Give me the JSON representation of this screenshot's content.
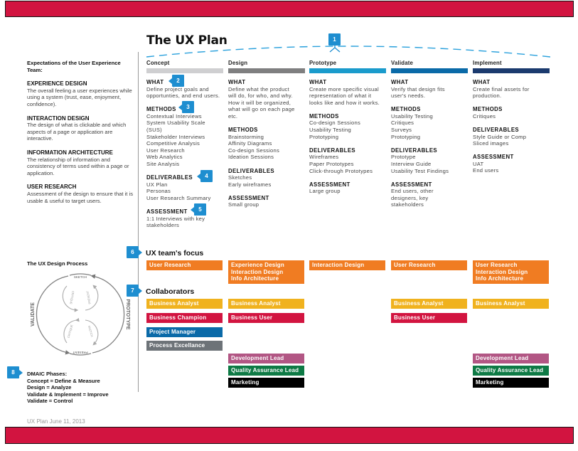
{
  "title": "The UX Plan",
  "intro": "Expectations of the User Experience Team:",
  "definitions": [
    {
      "term": "EXPERIENCE DESIGN",
      "desc": "The overall feeling a user experiences while using a system (trust, ease, enjoyment, confidence)."
    },
    {
      "term": "INTERACTION DESIGN",
      "desc": "The design of what is clickable and which aspects of a page or application are interactive."
    },
    {
      "term": "INFORMATION ARCHITECTURE",
      "desc": "The relationship of information and consistency of terms used within a page or application."
    },
    {
      "term": "USER RESEARCH",
      "desc": "Assessment of the design to ensure that it is usable & useful to target users."
    }
  ],
  "phases": [
    {
      "label": "Concept",
      "color": "#cfcfd1"
    },
    {
      "label": "Design",
      "color": "#7f7f80"
    },
    {
      "label": "Prototype",
      "color": "#1a9bcc"
    },
    {
      "label": "Validate",
      "color": "#0a6aa8"
    },
    {
      "label": "Implement",
      "color": "#1b3a6e"
    }
  ],
  "section_headers": {
    "what": "WHAT",
    "methods": "METHODS",
    "deliverables": "DELIVERABLES",
    "assessment": "ASSESSMENT"
  },
  "columns": [
    {
      "what": [
        "Define project goals and",
        "opportunties, and end users."
      ],
      "methods": [
        "Contextual Interviews",
        "System Usability Scale",
        "(SUS)",
        "Stakeholder Interviews",
        "Competitive Analysis",
        "User Research",
        "Web Analytics",
        "Site Analysis"
      ],
      "deliverables": [
        "UX Plan",
        "Personas",
        "User Research Summary"
      ],
      "assessment": [
        "1:1 Interviews with key",
        "stakeholders"
      ]
    },
    {
      "what": [
        "Define what the product",
        "will do, for who, and why.",
        "How it will be organized,",
        "what will go on each page",
        "etc."
      ],
      "methods": [
        "Brainstorming",
        "Affinity Diagrams",
        "Co-design Sessions",
        "Ideation Sessions"
      ],
      "deliverables": [
        "Sketches",
        "Early wireframes"
      ],
      "assessment": [
        "Small group"
      ]
    },
    {
      "what": [
        "Create more specific visual",
        "representation of what it",
        "looks like and how it works."
      ],
      "methods": [
        "Co-design Sessions",
        "Usability Testing",
        "Prototyping"
      ],
      "deliverables": [
        "Wireframes",
        "Paper Prototypes",
        "Click-through Prototypes"
      ],
      "assessment": [
        "Large group"
      ]
    },
    {
      "what": [
        "Verify that design fits",
        "user's needs."
      ],
      "methods": [
        "Usability Testing",
        "Critiques",
        "Surveys",
        "Prototyping"
      ],
      "deliverables": [
        "Prototype",
        "Interview Guide",
        "Usability Test Findings"
      ],
      "assessment": [
        "End users, other",
        "designers, key",
        "stakeholders"
      ]
    },
    {
      "what": [
        "Create final assets for",
        "production."
      ],
      "methods": [
        "Critiques"
      ],
      "deliverables": [
        "Style Guide or Comp",
        "Sliced images"
      ],
      "assessment": [
        "UAT",
        "End users"
      ]
    }
  ],
  "callouts": [
    "1",
    "2",
    "3",
    "4",
    "5",
    "6",
    "7",
    "8"
  ],
  "focus": {
    "title": "UX team's focus",
    "color": "#f07c22",
    "items": [
      [
        "User  Research"
      ],
      [
        "Experience Design",
        "Interaction Design",
        "Info Architecture"
      ],
      [
        "Interaction Design"
      ],
      [
        "User  Research"
      ],
      [
        "User  Research",
        "Interaction Design",
        "Info Architecture"
      ]
    ]
  },
  "collaborators": {
    "title": "Collaborators",
    "chips": [
      {
        "col": 0,
        "row": 0,
        "label": "Business Analyst",
        "color": "#f0b21e"
      },
      {
        "col": 0,
        "row": 1,
        "label": "Business Champion",
        "color": "#d21440"
      },
      {
        "col": 0,
        "row": 2,
        "label": "Project Manager",
        "color": "#0a6aa8"
      },
      {
        "col": 0,
        "row": 3,
        "label": "Process Excellance",
        "color": "#6d7378"
      },
      {
        "col": 1,
        "row": 0,
        "label": "Business Analyst",
        "color": "#f0b21e"
      },
      {
        "col": 1,
        "row": 1,
        "label": "Business User",
        "color": "#d21440"
      },
      {
        "col": 1,
        "row": 4,
        "label": "Development Lead",
        "color": "#b25684"
      },
      {
        "col": 1,
        "row": 5,
        "label": "Quality Assurance Lead",
        "color": "#0e7a45"
      },
      {
        "col": 1,
        "row": 6,
        "label": "Marketing",
        "color": "#000000"
      },
      {
        "col": 3,
        "row": 0,
        "label": "Business Analyst",
        "color": "#f0b21e"
      },
      {
        "col": 3,
        "row": 1,
        "label": "Business User",
        "color": "#d21440"
      },
      {
        "col": 4,
        "row": 0,
        "label": "Business Analyst",
        "color": "#f0b21e"
      },
      {
        "col": 4,
        "row": 4,
        "label": "Development Lead",
        "color": "#b25684"
      },
      {
        "col": 4,
        "row": 5,
        "label": "Quality Assurance Lead",
        "color": "#0e7a45"
      },
      {
        "col": 4,
        "row": 6,
        "label": "Marketing",
        "color": "#000000"
      }
    ]
  },
  "process": {
    "title": "The UX Design Process",
    "outer_left": "VALIDATE",
    "outer_right": "PROTOTYPE",
    "top": "SKETCH",
    "bottom": "PRESENT",
    "inner": [
      "CRITIQUE",
      "PRESENT",
      "CRITIQUE",
      "SKETCH"
    ]
  },
  "dmaic": [
    "DMAIC Phases:",
    "Concept = Define & Measure",
    "Design = Analyze",
    "Validate & Implement = Improve",
    "Validate = Control"
  ],
  "footer": "UX Plan  June 11, 2013",
  "accent": "#1e8ed0",
  "banner_color": "#d21440"
}
